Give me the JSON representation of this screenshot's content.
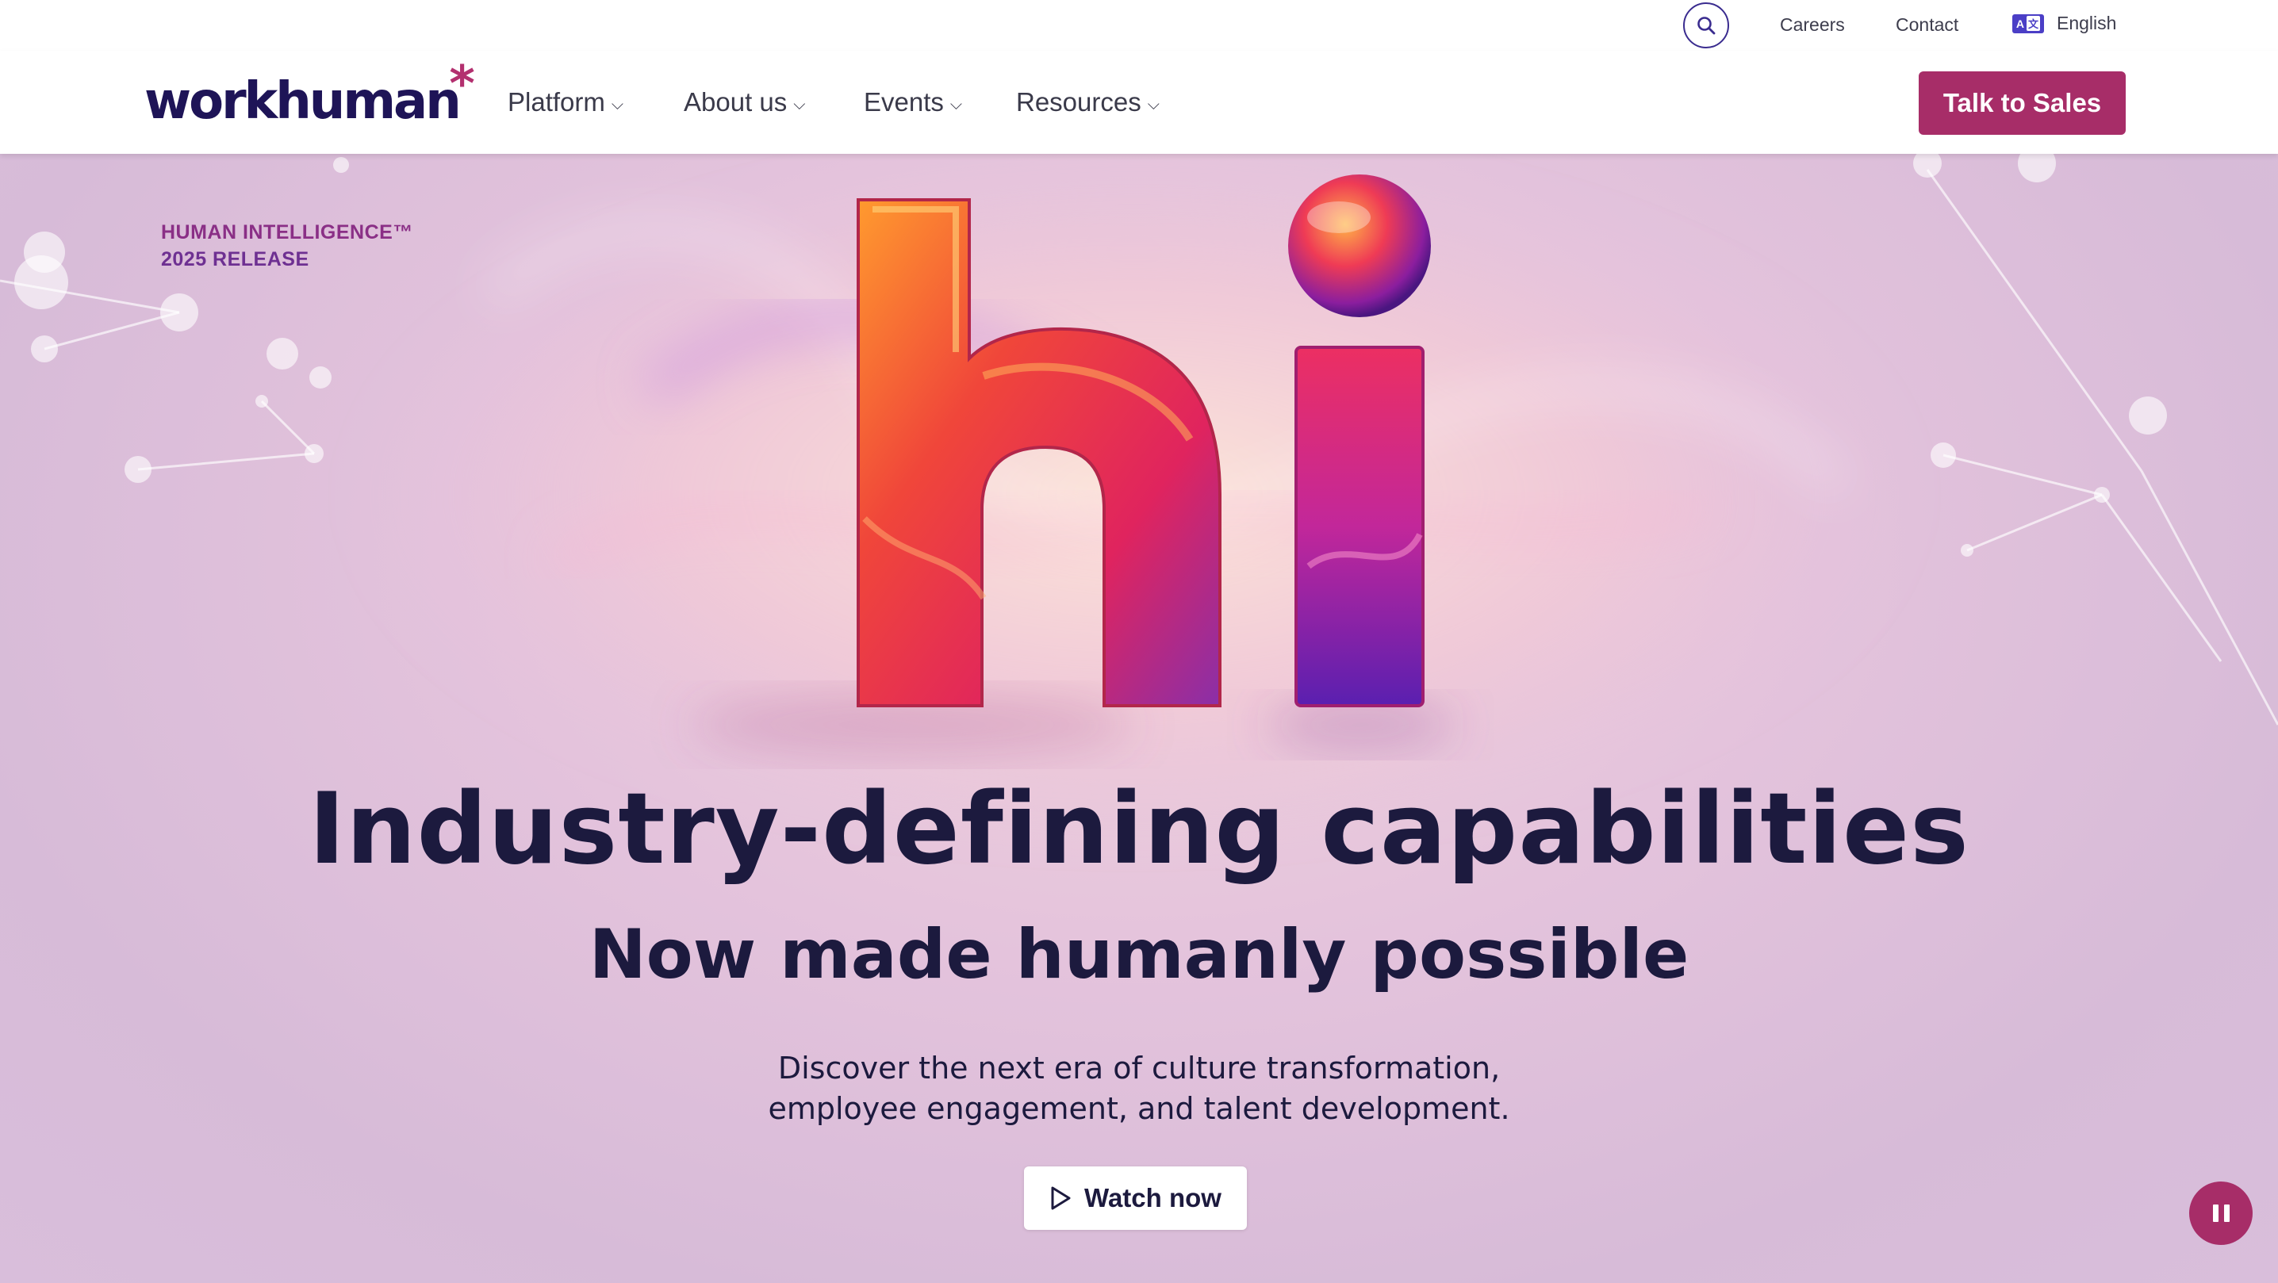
{
  "utility_nav": {
    "search_label": "Search",
    "careers": "Careers",
    "contact": "Contact",
    "language": "English"
  },
  "brand": {
    "logo_text": "workhuman",
    "logo_asterisk": "*",
    "accent_color": "#a72d68",
    "navy_color": "#1e1457"
  },
  "main_nav": {
    "items": [
      {
        "label": "Platform",
        "chevron": "⌵"
      },
      {
        "label": "About us",
        "chevron": "⌵"
      },
      {
        "label": "Events",
        "chevron": "⌵"
      },
      {
        "label": "Resources",
        "chevron": "⌵"
      }
    ],
    "cta_label": "Talk to Sales"
  },
  "hero": {
    "release_line1": "HUMAN INTELLIGENCE™",
    "release_line2": "2025 RELEASE",
    "art_text": "hi",
    "headline": "Industry-defining capabilities",
    "subheadline": "Now made humanly possible",
    "description_line1": "Discover the next era of culture transformation,",
    "description_line2": "employee engagement, and talent development.",
    "watch_label": "Watch now",
    "pause_label": "Pause"
  },
  "icons": {
    "search": "search-icon",
    "language": "translate-icon",
    "play": "play-icon",
    "pause": "pause-icon"
  }
}
